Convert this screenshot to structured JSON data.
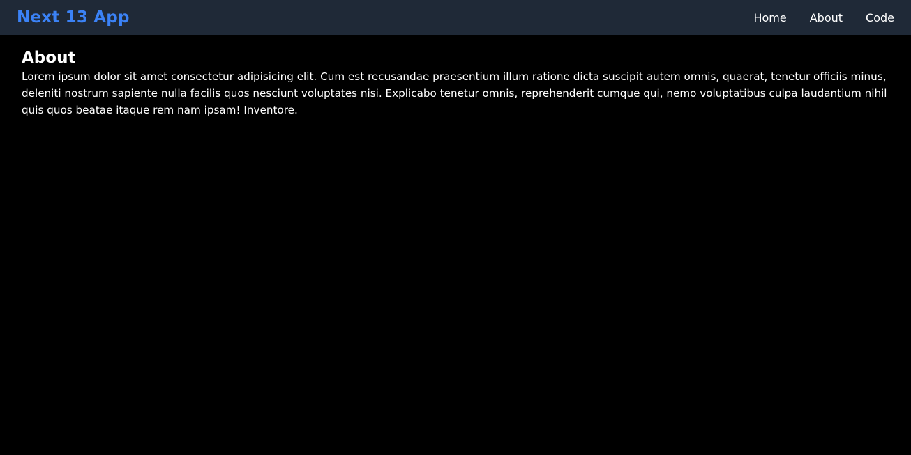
{
  "navbar": {
    "brand": "Next 13 App",
    "links": [
      {
        "label": "Home"
      },
      {
        "label": "About"
      },
      {
        "label": "Code"
      }
    ]
  },
  "main": {
    "title": "About",
    "paragraph": "Lorem ipsum dolor sit amet consectetur adipisicing elit. Cum est recusandae praesentium illum ratione dicta suscipit autem omnis, quaerat, tenetur officiis minus, deleniti nostrum sapiente nulla facilis quos nesciunt voluptates nisi. Explicabo tenetur omnis, reprehenderit cumque qui, nemo voluptatibus culpa laudantium nihil quis quos beatae itaque rem nam ipsam! Inventore."
  },
  "colors": {
    "navbar_bg": "#1f2937",
    "brand": "#3b82f6",
    "page_bg": "#000000",
    "text": "#ffffff"
  }
}
